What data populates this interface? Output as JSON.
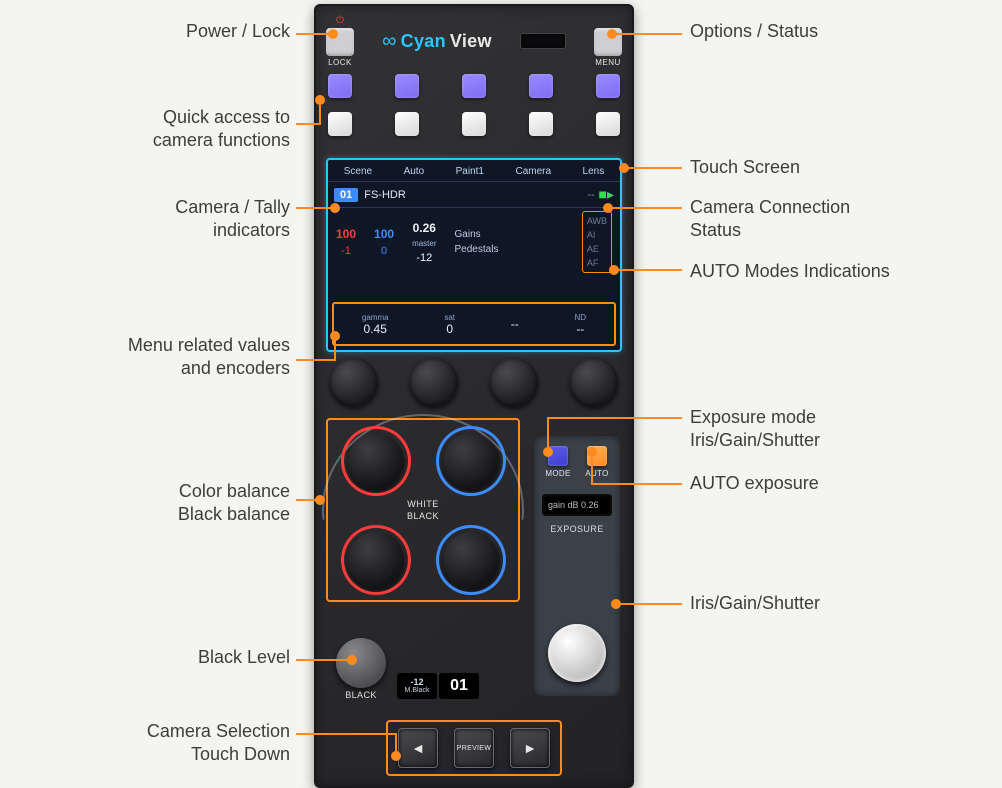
{
  "brand": {
    "name_a": "Cyan",
    "name_b": "View"
  },
  "top_buttons": {
    "left_label": "LOCK",
    "right_label": "MENU",
    "power_glyph": "⏻"
  },
  "screen": {
    "tabs": [
      "Scene",
      "Auto",
      "Paint1",
      "Camera",
      "Lens"
    ],
    "camera_number": "01",
    "camera_model": "FS-HDR",
    "model_extra": "--",
    "gains_label": "Gains",
    "pedestals_label": "Pedestals",
    "master_label": "master",
    "values": {
      "red_gain": "100",
      "blue_gain": "100",
      "master_gain": "0.26",
      "red_ped": "-1",
      "blue_ped": "0",
      "master_ped": "-12"
    },
    "auto_modes": [
      "AWB",
      "AI",
      "AE",
      "AF"
    ],
    "bottom_row": [
      "0.45",
      "0",
      "--",
      "--"
    ],
    "bottom_tiny": [
      "gamma",
      "sat",
      "",
      "ND"
    ]
  },
  "color_balance": {
    "white_label": "WHITE",
    "black_label": "BLACK"
  },
  "exposure": {
    "mode_label": "MODE",
    "auto_label": "AUTO",
    "oled_text": "gain dB 0.26",
    "title": "EXPOSURE"
  },
  "black_level": {
    "value": "-12",
    "sub": "M.Black",
    "cam": "01",
    "knob_label": "BLACK"
  },
  "cam_sel": {
    "prev": "◄",
    "preview": "PREVIEW",
    "next": "►"
  },
  "callouts": {
    "power_lock": "Power / Lock",
    "options_status": "Options / Status",
    "quick_access": "Quick access to\ncamera functions",
    "touch_screen": "Touch Screen",
    "camera_tally": "Camera / Tally\nindicators",
    "conn_status": "Camera Connection\nStatus",
    "auto_modes": "AUTO Modes Indications",
    "menu_encoders": "Menu related values\nand encoders",
    "exposure_mode": "Exposure mode\nIris/Gain/Shutter",
    "color_balance": "Color balance\nBlack balance",
    "auto_exposure": "AUTO exposure",
    "iris_gain_shutter": "Iris/Gain/Shutter",
    "black_level": "Black Level",
    "cam_selection": "Camera Selection\nTouch Down"
  }
}
